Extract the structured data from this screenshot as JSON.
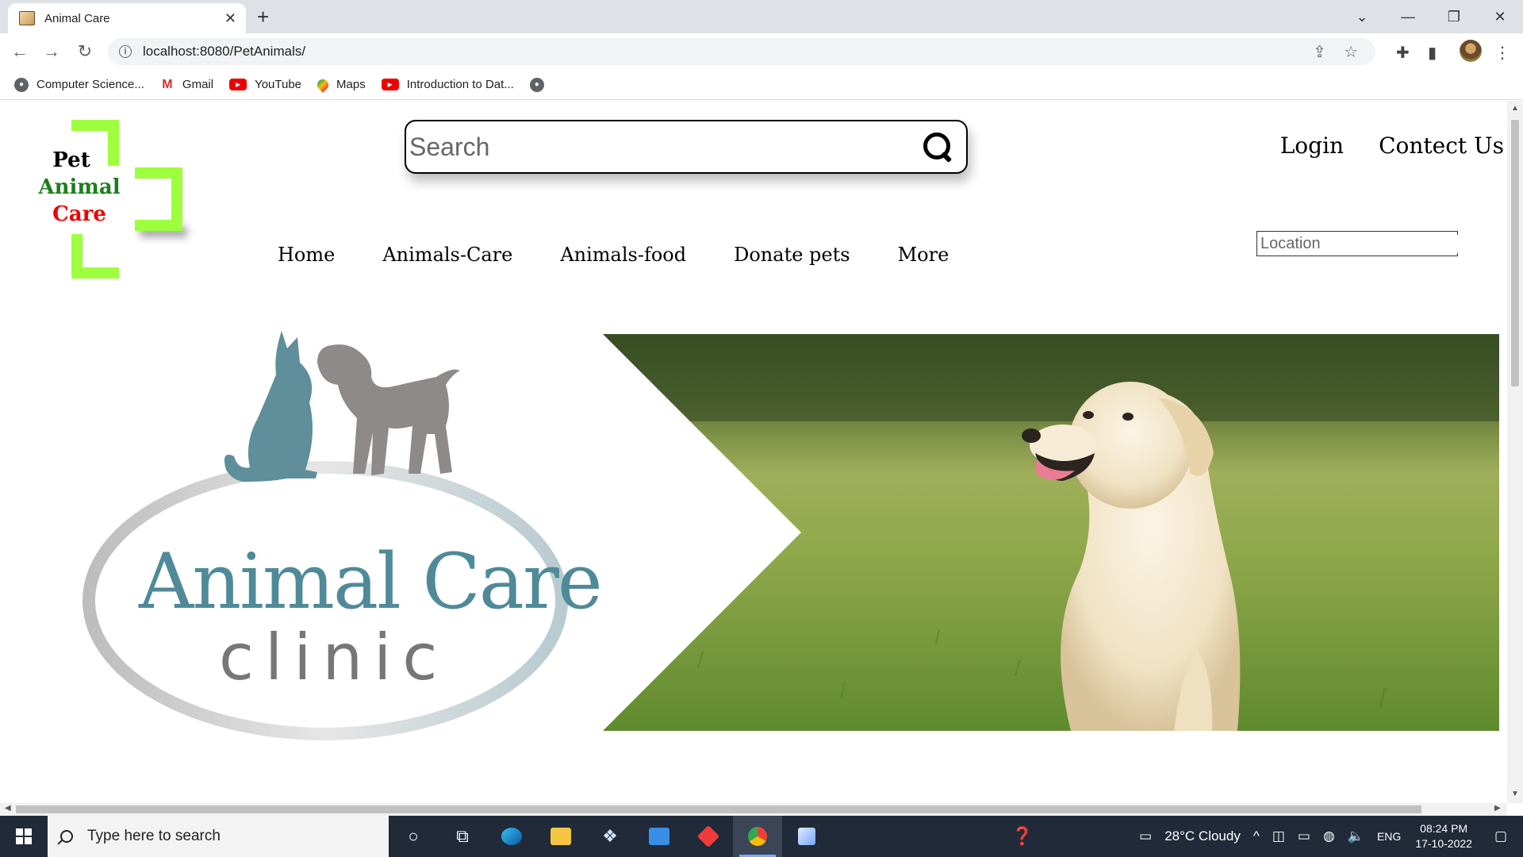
{
  "browser": {
    "tab_title": "Animal Care",
    "url": "localhost:8080/PetAnimals/",
    "bookmarks": [
      "Computer Science...",
      "Gmail",
      "YouTube",
      "Maps",
      "Introduction to Dat..."
    ]
  },
  "page": {
    "brand": {
      "line1": "Pet",
      "line2": "Animal",
      "line3": "Care"
    },
    "search": {
      "placeholder": "Search"
    },
    "top_links": {
      "login": "Login",
      "contact": "Contect Us"
    },
    "location": {
      "placeholder": "Location"
    },
    "menu": [
      "Home",
      "Animals-Care",
      "Animals-food",
      "Donate pets",
      "More"
    ],
    "clinic_logo": {
      "line1": "Animal Care",
      "line2": "clinic"
    }
  },
  "taskbar": {
    "search_placeholder": "Type here to search",
    "weather": "28°C  Cloudy",
    "lang": "ENG",
    "time": "08:24 PM",
    "date": "17-10-2022"
  },
  "colors": {
    "brand_green": "#9dff3d",
    "brand_text_green": "#1b7f1b",
    "brand_text_red": "#e00000",
    "clinic_teal": "#4f8a99",
    "clinic_gray": "#777777"
  }
}
